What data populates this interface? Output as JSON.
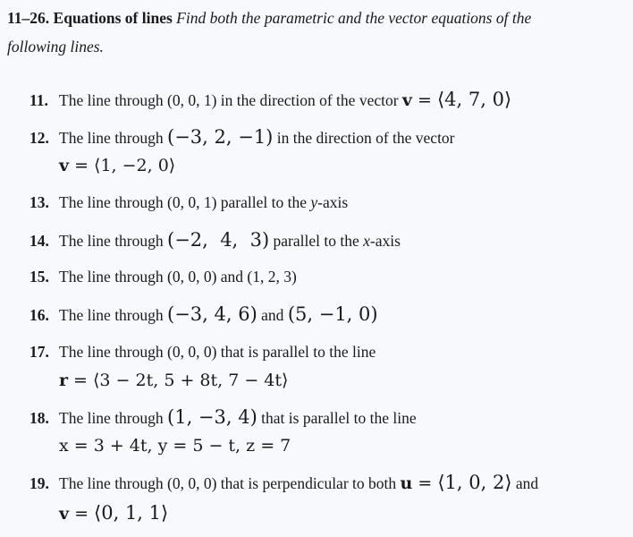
{
  "header": {
    "number_range": "11–26.",
    "title": "Equations of lines",
    "instruction_line1": "Find both the parametric and the vector equations of the",
    "instruction_line2": "following lines."
  },
  "problems": [
    {
      "num": "11.",
      "text": "The line through (0, 0, 1) in the direction of the vector",
      "vec": "v",
      "eq": " = ",
      "math": "⟨4, 7, 0⟩"
    },
    {
      "num": "12.",
      "text": "The line through",
      "math": "(−3, 2, −1)",
      "text2": "in the direction of the vector",
      "line2_vec": "v",
      "line2_eq": " = ",
      "line2_math": "⟨1, −2, 0⟩"
    },
    {
      "num": "13.",
      "text": "The line through (0, 0, 1) parallel to the",
      "axis": "y",
      "suffix": "-axis"
    },
    {
      "num": "14.",
      "text": "The line through",
      "math": "(−2,  4,  3)",
      "text2": "parallel to the",
      "axis": "x",
      "suffix": "-axis"
    },
    {
      "num": "15.",
      "text": "The line through (0, 0, 0) and (1, 2, 3)"
    },
    {
      "num": "16.",
      "text": "The line through",
      "math": "(−3, 4, 6)",
      "text2": "and",
      "math2": "(5, −1, 0)"
    },
    {
      "num": "17.",
      "text": "The line through (0, 0, 0) that is parallel to the line",
      "line2_vec": "r",
      "line2_eq": " = ",
      "line2_math": "⟨3 − 2t, 5 + 8t, 7 − 4t⟩"
    },
    {
      "num": "18.",
      "text": "The line through",
      "math": "(1, −3, 4)",
      "text2": "that is parallel to the line",
      "line2_math": "x = 3 + 4t, y = 5 − t, z = 7"
    },
    {
      "num": "19.",
      "text": "The line through (0, 0, 0) that is perpendicular to both",
      "vec": "u",
      "eq": " = ",
      "math": "⟨1, 0, 2⟩",
      "text2": "and",
      "line2_vec": "v",
      "line2_eq": " = ",
      "line2_math": "⟨0, 1, 1⟩"
    }
  ]
}
